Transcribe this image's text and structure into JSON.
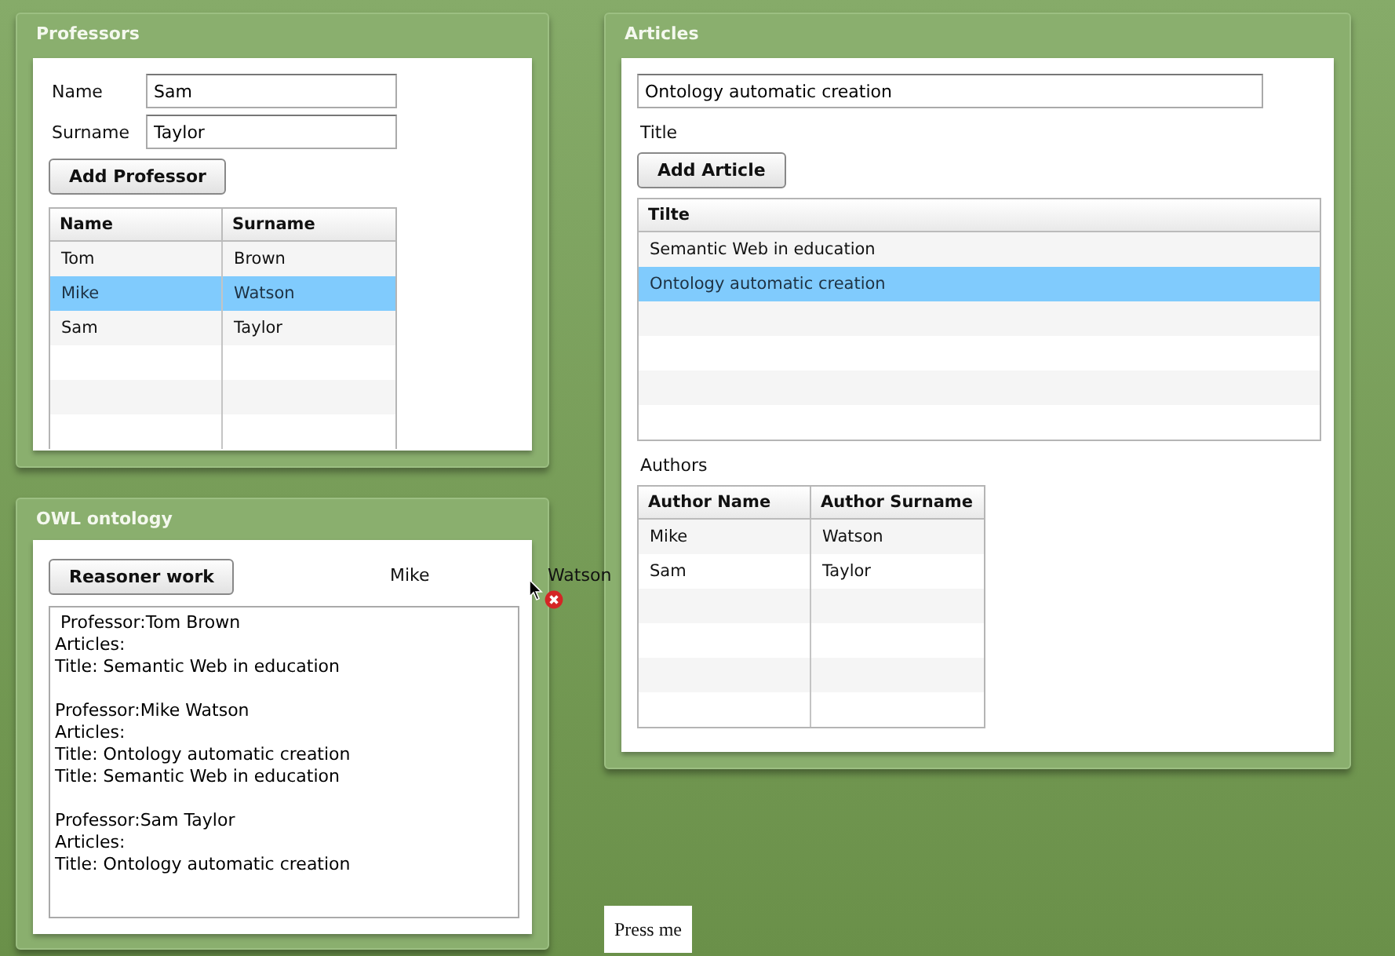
{
  "professors": {
    "title": "Professors",
    "fields": [
      {
        "label": "Name",
        "value": "Sam"
      },
      {
        "label": "Surname",
        "value": "Taylor"
      }
    ],
    "button": "Add Professor",
    "table": {
      "columns": [
        "Name",
        "Surname"
      ],
      "rows": [
        {
          "cells": [
            "Tom",
            "Brown"
          ],
          "selected": false
        },
        {
          "cells": [
            "Mike",
            "Watson"
          ],
          "selected": true
        },
        {
          "cells": [
            "Sam",
            "Taylor"
          ],
          "selected": false
        }
      ]
    }
  },
  "owl": {
    "title": "OWL ontology",
    "button": "Reasoner work",
    "selected_name": "Mike",
    "output_blocks": [
      [
        " Professor:Tom Brown",
        "Articles:",
        "Title: Semantic Web in education"
      ],
      [
        "Professor:Mike Watson",
        "Articles:",
        "Title: Ontology automatic creation",
        "Title: Semantic Web in education"
      ],
      [
        "Professor:Sam Taylor",
        "Articles:",
        "Title: Ontology automatic creation"
      ]
    ]
  },
  "articles": {
    "title": "Articles",
    "title_field": {
      "value": "Ontology automatic creation",
      "label": "Title"
    },
    "button": "Add Article",
    "table": {
      "columns": [
        "Tilte"
      ],
      "rows": [
        {
          "cells": [
            "Semantic Web in education"
          ],
          "selected": false
        },
        {
          "cells": [
            "Ontology automatic creation"
          ],
          "selected": true
        }
      ]
    },
    "authors_label": "Authors",
    "authors_table": {
      "columns": [
        "Author Name",
        "Author Surname"
      ],
      "rows": [
        {
          "cells": [
            "Mike",
            "Watson"
          ],
          "selected": false
        },
        {
          "cells": [
            "Sam",
            "Taylor"
          ],
          "selected": false
        }
      ]
    }
  },
  "floating_label": "Watson",
  "press_button": "Press me"
}
